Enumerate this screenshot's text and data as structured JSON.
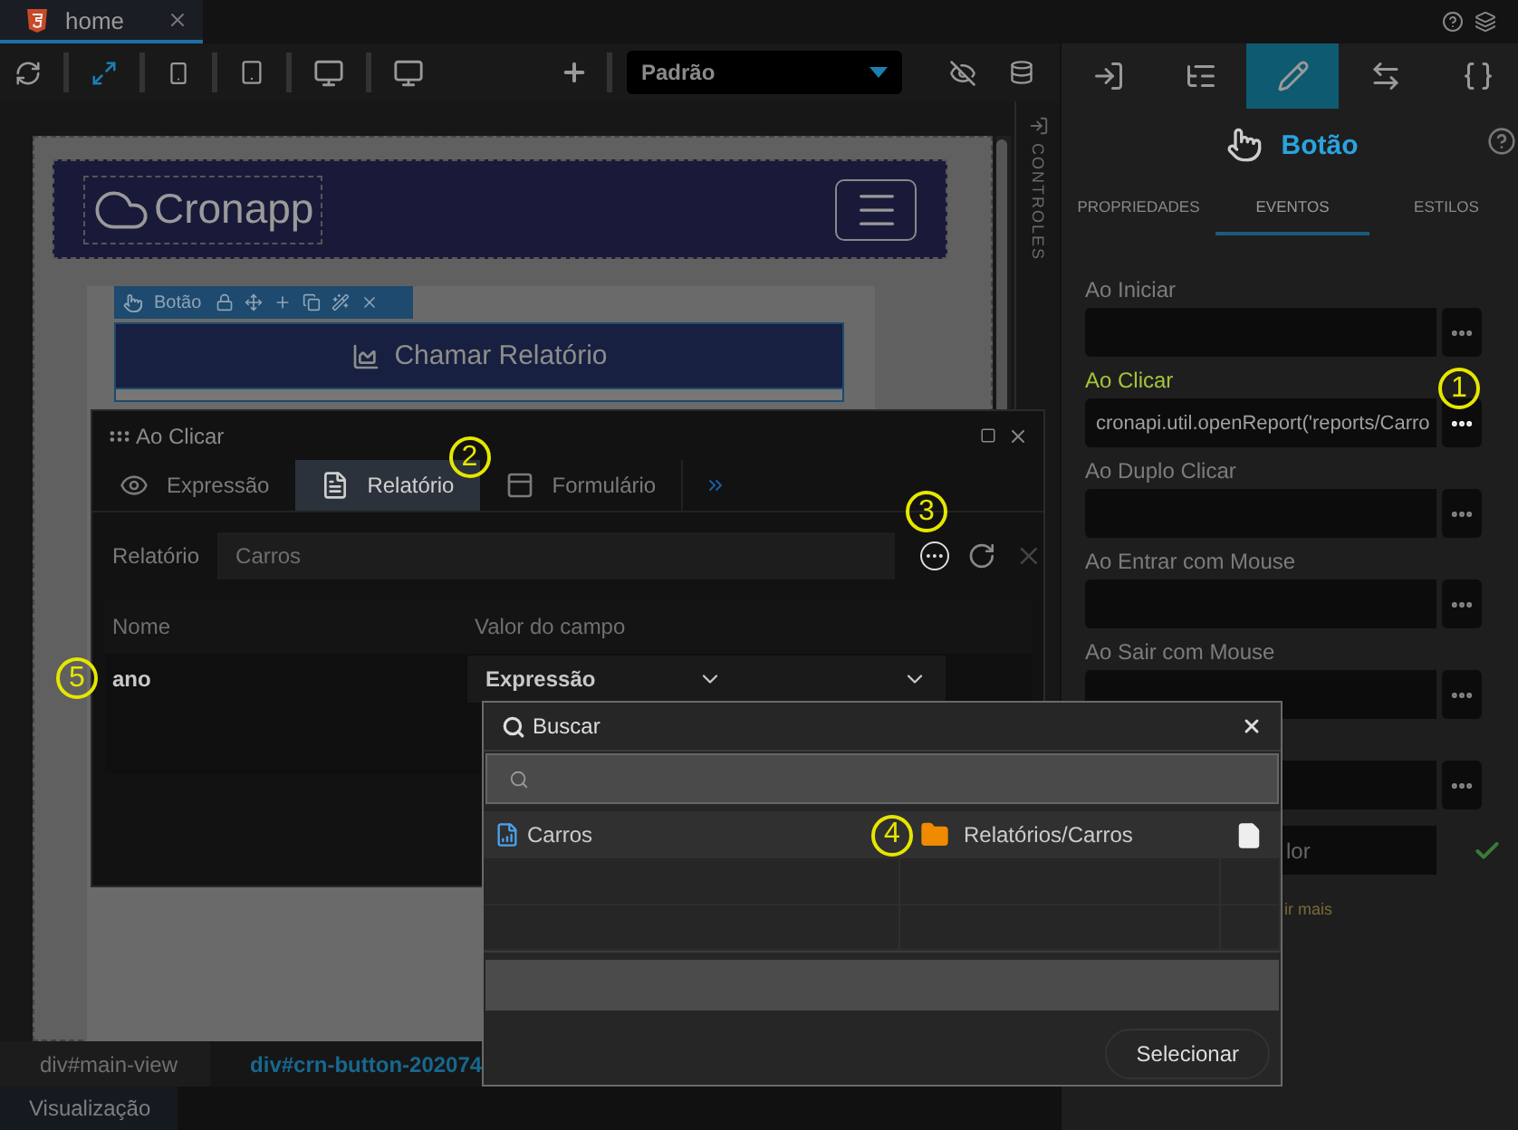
{
  "editor_tab": {
    "title": "home"
  },
  "toolbar": {
    "theme_select": "Padrão"
  },
  "canvas": {
    "logo": "Cronapp",
    "component_bar": {
      "label": "Botão"
    },
    "button": {
      "label": "Chamar Relatório"
    }
  },
  "side_strip": {
    "label": "CONTROLES"
  },
  "breadcrumb": [
    {
      "label": "div#main-view",
      "selected": false
    },
    {
      "label": "div#crn-button-202074",
      "selected": true
    }
  ],
  "bottom_tab": {
    "label": "Visualização"
  },
  "inspector": {
    "icon_tabs": [
      {
        "kind": "entry",
        "selected": false
      },
      {
        "kind": "tree",
        "selected": false
      },
      {
        "kind": "edit",
        "selected": true
      },
      {
        "kind": "resize",
        "selected": false
      },
      {
        "kind": "code",
        "selected": false
      }
    ],
    "title": "Botão",
    "tabs": [
      {
        "label": "PROPRIEDADES",
        "selected": false
      },
      {
        "label": "EVENTOS",
        "selected": true
      },
      {
        "label": "ESTILOS",
        "selected": false
      }
    ],
    "events": [
      {
        "label": "Ao Iniciar",
        "active": false
      },
      {
        "label": "Ao Clicar",
        "active": true,
        "value": "cronapi.util.openReport('reports/Carro",
        "callout": "1"
      },
      {
        "label": "Ao Duplo Clicar",
        "active": false
      },
      {
        "label": "Ao Entrar com Mouse",
        "active": false
      },
      {
        "label": "Ao Sair com Mouse",
        "active": false
      },
      {
        "active": false
      }
    ],
    "value_field": "lor",
    "more_link": "ir mais"
  },
  "dialog": {
    "title": "Ao Clicar",
    "tabs": [
      {
        "label": "Expressão",
        "kind": "eye",
        "selected": false
      },
      {
        "label": "Relatório",
        "kind": "report",
        "selected": true,
        "callout": "2"
      },
      {
        "label": "Formulário",
        "kind": "form",
        "selected": false
      }
    ],
    "report_field": {
      "label": "Relatório",
      "value": "Carros",
      "callout": "3"
    },
    "table": {
      "columns": [
        "Nome",
        "Valor do campo"
      ],
      "rows": [
        {
          "name": "ano",
          "value": "Expressão",
          "callout": "5"
        }
      ]
    }
  },
  "search_dialog": {
    "title": "Buscar",
    "results": [
      {
        "name": "Carros",
        "path": "Relatórios/Carros",
        "callout": "4"
      }
    ],
    "button": "Selecionar"
  }
}
